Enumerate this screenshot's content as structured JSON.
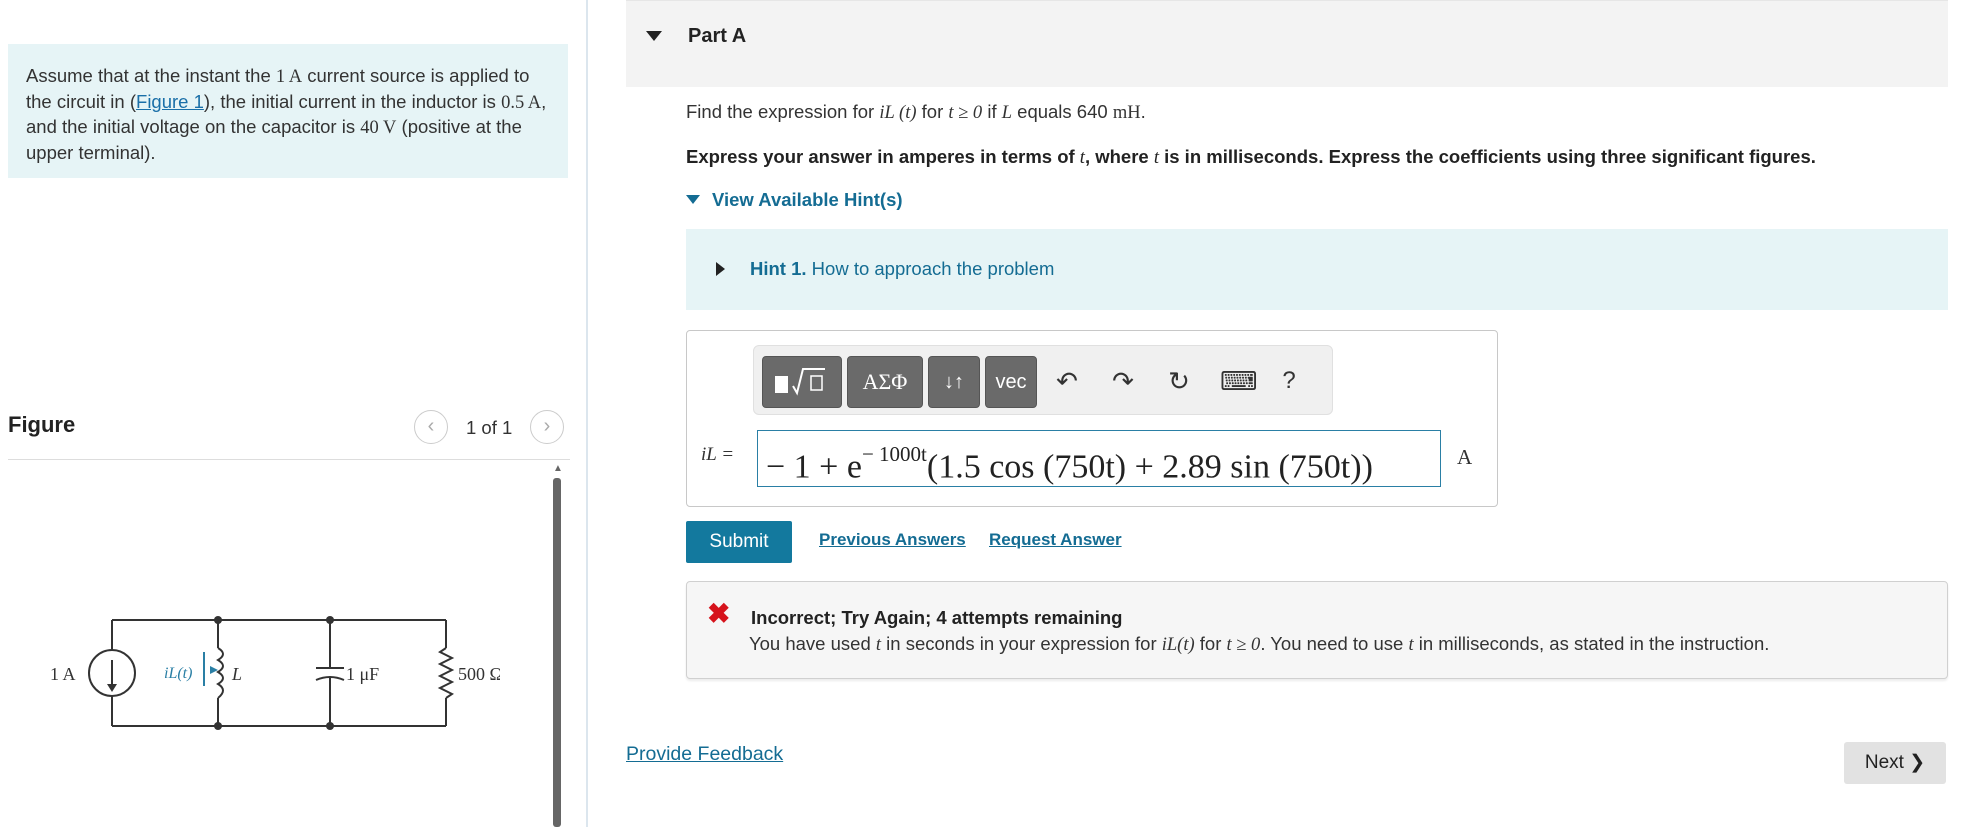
{
  "intro": {
    "p1": "Assume that at the instant the ",
    "m1": "1 A",
    "p2": " current source is applied to the circuit in (",
    "figure_link": "Figure 1",
    "p3": "), the initial current in the inductor is ",
    "m2": "0.5 A",
    "p4": ", and the initial voltage on the capacitor is ",
    "m3": "40 V",
    "p5": " (positive at the upper terminal)."
  },
  "figure": {
    "title": "Figure",
    "counter": "1 of 1",
    "prev_icon": "chevron-left-icon",
    "next_icon": "chevron-right-icon",
    "source_label": "1 A",
    "inductor_current_label": "iL(t)",
    "inductor_label": "L",
    "capacitor_label": "1 μF",
    "resistor_label": "500 Ω"
  },
  "part": {
    "title": "Part A",
    "question_prefix": "Find the expression for ",
    "question_var": "iL (t)",
    "question_mid": " for ",
    "question_cond": "t ≥ 0",
    "question_if": " if ",
    "question_L": "L",
    "question_equals": " equals 640 ",
    "question_unit": "mH",
    "question_end": ".",
    "instruction_a": "Express your answer in amperes in terms of ",
    "instruction_t1": "t",
    "instruction_b": ", where ",
    "instruction_t2": "t",
    "instruction_c": " is in milliseconds. Express the coefficients using three significant figures.",
    "hints_toggle": "View Available Hint(s)",
    "hint_label": "Hint 1.",
    "hint_text": " How to approach the problem"
  },
  "toolbar": {
    "greek": "ΑΣΦ",
    "arrows": "↓↑",
    "vec": "vec",
    "undo": "↶",
    "redo": "↷",
    "reset": "↻",
    "keyboard": "⌨",
    "help": "?"
  },
  "answer": {
    "label": "iL =",
    "expression": "− 1 + e",
    "exponent": "− 1000t",
    "expression_rest": "(1.5 cos (750t) + 2.89 sin (750t))",
    "unit": "A"
  },
  "actions": {
    "submit": "Submit",
    "previous_answers": "Previous Answers",
    "request_answer": "Request Answer"
  },
  "feedback": {
    "title": "Incorrect; Try Again; 4 attempts remaining",
    "msg_a": "You have used ",
    "msg_t1": "t",
    "msg_b": " in seconds in your expression for ",
    "msg_var": "iL(t)",
    "msg_c": " for ",
    "msg_cond": "t ≥ 0",
    "msg_d": ". You need to use ",
    "msg_t2": "t",
    "msg_e": " in milliseconds, as stated in the instruction."
  },
  "footer": {
    "provide_feedback": "Provide Feedback",
    "next": "Next ❯"
  },
  "colors": {
    "accent": "#13799e",
    "link": "#146c93",
    "hint_bg": "#e6f4f6",
    "error": "#d6131c"
  }
}
